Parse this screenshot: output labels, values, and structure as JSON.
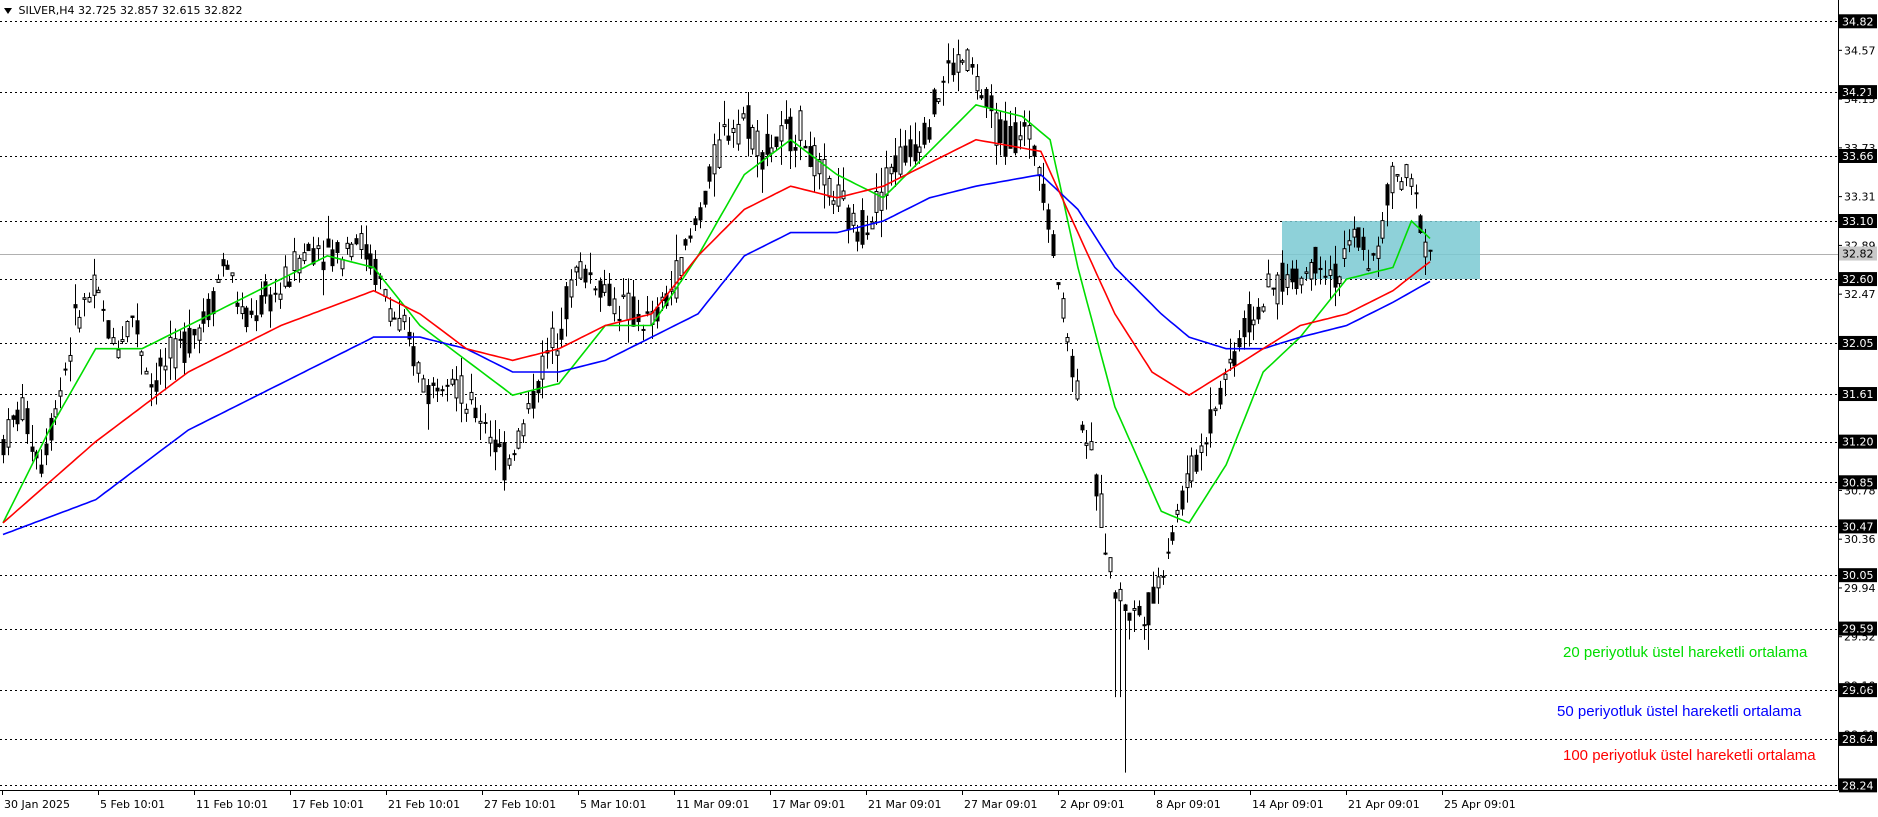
{
  "header": {
    "symbol": "SILVER,H4",
    "ohlc": "32.725 32.857 32.615 32.822"
  },
  "legend": [
    {
      "text": "20 periyotluk üstel hareketli ortalama",
      "color": "#00dd00"
    },
    {
      "text": "50 periyotluk üstel hareketli ortalama",
      "color": "#0000ff"
    },
    {
      "text": "100 periyotluk üstel hareketli ortalama",
      "color": "#ff0000"
    }
  ],
  "chart_data": {
    "type": "candlestick",
    "x_labels": [
      "30 Jan 2025",
      "5 Feb 10:01",
      "11 Feb 10:01",
      "17 Feb 10:01",
      "21 Feb 10:01",
      "27 Feb 10:01",
      "5 Mar 10:01",
      "11 Mar 09:01",
      "17 Mar 09:01",
      "21 Mar 09:01",
      "27 Mar 09:01",
      "2 Apr 09:01",
      "8 Apr 09:01",
      "14 Apr 09:01",
      "21 Apr 09:01",
      "25 Apr 09:01"
    ],
    "y_tick_labels": [
      "34.82",
      "34.57",
      "34.21",
      "34.15",
      "33.73",
      "33.66",
      "33.31",
      "33.10",
      "32.89",
      "32.82",
      "32.60",
      "32.47",
      "32.05",
      "31.61",
      "31.20",
      "30.85",
      "30.78",
      "30.47",
      "30.36",
      "30.05",
      "29.94",
      "29.59",
      "29.52",
      "29.06",
      "29.10",
      "28.68",
      "28.64",
      "28.24"
    ],
    "ylim": [
      28.2,
      34.9
    ],
    "horizontal_levels": [
      34.82,
      34.21,
      33.66,
      33.1,
      32.6,
      32.05,
      31.61,
      31.2,
      30.85,
      30.47,
      30.05,
      29.59,
      29.06,
      28.64,
      28.24
    ],
    "current_price": 32.82,
    "highlight_zone": {
      "from": "14 Apr 09:01",
      "to": "25 Apr 09:01",
      "low": 32.6,
      "high": 33.1,
      "color": "#7ac9d2"
    },
    "price_path": [
      [
        0,
        31.2
      ],
      [
        2,
        31.5
      ],
      [
        4,
        31.0
      ],
      [
        6,
        31.6
      ],
      [
        8,
        32.3
      ],
      [
        10,
        32.5
      ],
      [
        12,
        32.0
      ],
      [
        14,
        32.3
      ],
      [
        16,
        31.7
      ],
      [
        18,
        31.9
      ],
      [
        20,
        32.1
      ],
      [
        22,
        32.3
      ],
      [
        24,
        32.8
      ],
      [
        26,
        32.2
      ],
      [
        28,
        32.4
      ],
      [
        30,
        32.5
      ],
      [
        32,
        32.8
      ],
      [
        34,
        32.9
      ],
      [
        36,
        32.8
      ],
      [
        38,
        33.0
      ],
      [
        40,
        32.7
      ],
      [
        42,
        32.3
      ],
      [
        44,
        32.0
      ],
      [
        46,
        31.6
      ],
      [
        48,
        31.9
      ],
      [
        50,
        31.5
      ],
      [
        52,
        31.4
      ],
      [
        54,
        31.0
      ],
      [
        56,
        31.3
      ],
      [
        58,
        31.8
      ],
      [
        60,
        32.2
      ],
      [
        62,
        32.7
      ],
      [
        64,
        32.6
      ],
      [
        66,
        32.4
      ],
      [
        68,
        32.3
      ],
      [
        70,
        32.2
      ],
      [
        72,
        32.5
      ],
      [
        74,
        32.9
      ],
      [
        76,
        33.4
      ],
      [
        78,
        33.9
      ],
      [
        80,
        34.0
      ],
      [
        82,
        33.7
      ],
      [
        84,
        33.8
      ],
      [
        86,
        33.9
      ],
      [
        88,
        33.5
      ],
      [
        90,
        33.3
      ],
      [
        92,
        33.0
      ],
      [
        94,
        33.2
      ],
      [
        96,
        33.6
      ],
      [
        98,
        33.7
      ],
      [
        100,
        34.0
      ],
      [
        102,
        34.4
      ],
      [
        104,
        34.5
      ],
      [
        106,
        34.1
      ],
      [
        108,
        33.8
      ],
      [
        110,
        33.9
      ],
      [
        112,
        33.6
      ],
      [
        114,
        32.5
      ],
      [
        116,
        31.6
      ],
      [
        118,
        30.8
      ],
      [
        120,
        29.9
      ],
      [
        122,
        29.7
      ],
      [
        124,
        29.8
      ],
      [
        126,
        30.4
      ],
      [
        128,
        30.9
      ],
      [
        130,
        31.3
      ],
      [
        132,
        31.8
      ],
      [
        134,
        32.2
      ],
      [
        136,
        32.4
      ],
      [
        138,
        32.6
      ],
      [
        140,
        32.6
      ],
      [
        142,
        32.8
      ],
      [
        144,
        32.6
      ],
      [
        146,
        33.0
      ],
      [
        148,
        32.7
      ],
      [
        150,
        33.5
      ],
      [
        152,
        33.4
      ],
      [
        154,
        32.82
      ]
    ],
    "ema": [
      {
        "name": "20 periyotluk üstel hareketli ortalama",
        "color": "#00dd00",
        "values": [
          [
            0,
            30.5
          ],
          [
            5,
            31.3
          ],
          [
            10,
            32.0
          ],
          [
            15,
            32.0
          ],
          [
            20,
            32.2
          ],
          [
            25,
            32.4
          ],
          [
            30,
            32.6
          ],
          [
            35,
            32.8
          ],
          [
            40,
            32.7
          ],
          [
            45,
            32.2
          ],
          [
            50,
            31.9
          ],
          [
            55,
            31.6
          ],
          [
            60,
            31.7
          ],
          [
            65,
            32.2
          ],
          [
            70,
            32.2
          ],
          [
            75,
            32.8
          ],
          [
            80,
            33.5
          ],
          [
            85,
            33.8
          ],
          [
            90,
            33.5
          ],
          [
            95,
            33.3
          ],
          [
            100,
            33.7
          ],
          [
            105,
            34.1
          ],
          [
            110,
            34.0
          ],
          [
            113,
            33.8
          ],
          [
            116,
            32.7
          ],
          [
            120,
            31.5
          ],
          [
            125,
            30.6
          ],
          [
            128,
            30.5
          ],
          [
            132,
            31.0
          ],
          [
            136,
            31.8
          ],
          [
            140,
            32.1
          ],
          [
            145,
            32.6
          ],
          [
            150,
            32.7
          ],
          [
            152,
            33.1
          ],
          [
            154,
            32.95
          ]
        ]
      },
      {
        "name": "50 periyotluk üstel hareketli ortalama",
        "color": "#0000ff",
        "values": [
          [
            0,
            30.4
          ],
          [
            10,
            30.7
          ],
          [
            20,
            31.3
          ],
          [
            30,
            31.7
          ],
          [
            40,
            32.1
          ],
          [
            45,
            32.1
          ],
          [
            50,
            32.0
          ],
          [
            55,
            31.8
          ],
          [
            60,
            31.8
          ],
          [
            65,
            31.9
          ],
          [
            70,
            32.1
          ],
          [
            75,
            32.3
          ],
          [
            80,
            32.8
          ],
          [
            85,
            33.0
          ],
          [
            90,
            33.0
          ],
          [
            95,
            33.1
          ],
          [
            100,
            33.3
          ],
          [
            105,
            33.4
          ],
          [
            112,
            33.5
          ],
          [
            116,
            33.2
          ],
          [
            120,
            32.7
          ],
          [
            125,
            32.3
          ],
          [
            128,
            32.1
          ],
          [
            132,
            32.0
          ],
          [
            136,
            32.0
          ],
          [
            140,
            32.1
          ],
          [
            145,
            32.2
          ],
          [
            150,
            32.4
          ],
          [
            154,
            32.58
          ]
        ]
      },
      {
        "name": "100 periyotluk üstel hareketli ortalama",
        "color": "#ff0000",
        "values": [
          [
            0,
            30.5
          ],
          [
            10,
            31.2
          ],
          [
            20,
            31.8
          ],
          [
            30,
            32.2
          ],
          [
            40,
            32.5
          ],
          [
            45,
            32.3
          ],
          [
            50,
            32.0
          ],
          [
            55,
            31.9
          ],
          [
            60,
            32.0
          ],
          [
            65,
            32.2
          ],
          [
            70,
            32.3
          ],
          [
            75,
            32.8
          ],
          [
            80,
            33.2
          ],
          [
            85,
            33.4
          ],
          [
            90,
            33.3
          ],
          [
            95,
            33.4
          ],
          [
            100,
            33.6
          ],
          [
            105,
            33.8
          ],
          [
            112,
            33.7
          ],
          [
            116,
            33.0
          ],
          [
            120,
            32.3
          ],
          [
            124,
            31.8
          ],
          [
            128,
            31.6
          ],
          [
            132,
            31.8
          ],
          [
            136,
            32.0
          ],
          [
            140,
            32.2
          ],
          [
            145,
            32.3
          ],
          [
            150,
            32.5
          ],
          [
            154,
            32.75
          ]
        ]
      }
    ]
  }
}
